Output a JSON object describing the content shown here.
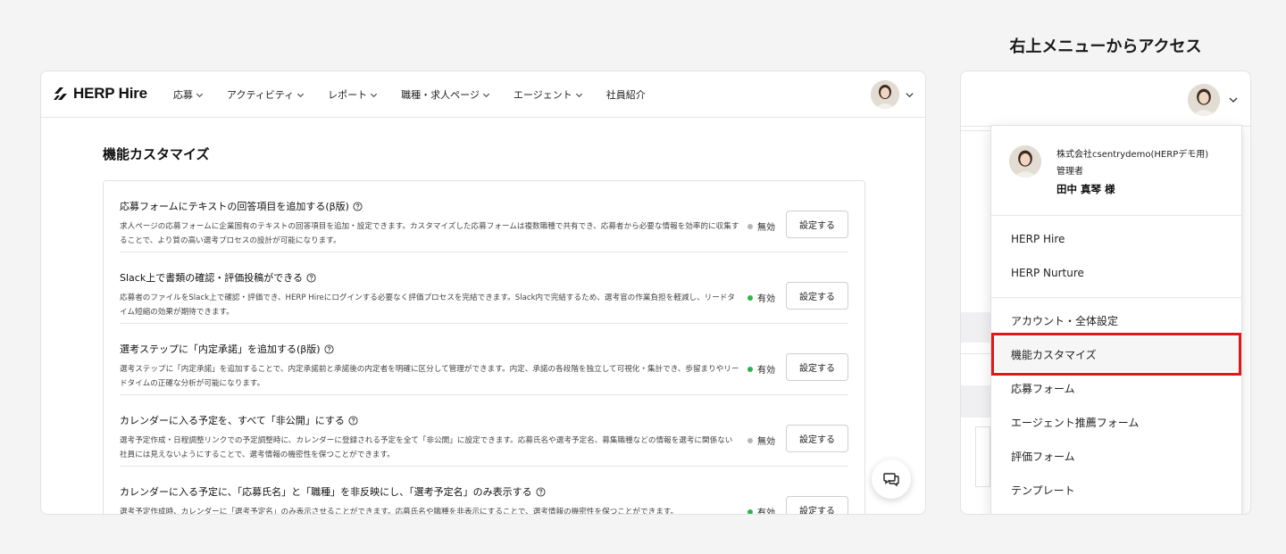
{
  "app": {
    "logo_text": "HERP Hire"
  },
  "nav": {
    "items": [
      {
        "label": "応募",
        "has_dropdown": true
      },
      {
        "label": "アクティビティ",
        "has_dropdown": true
      },
      {
        "label": "レポート",
        "has_dropdown": true
      },
      {
        "label": "職種・求人ページ",
        "has_dropdown": true
      },
      {
        "label": "エージェント",
        "has_dropdown": true
      },
      {
        "label": "社員紹介",
        "has_dropdown": false
      }
    ]
  },
  "page": {
    "title": "機能カスタマイズ"
  },
  "features": [
    {
      "title": "応募フォームにテキストの回答項目を追加する(β版)",
      "description": "求人ページの応募フォームに企業固有のテキストの回答項目を追加・設定できます。カスタマイズした応募フォームは複数職種で共有でき、応募者から必要な情報を効率的に収集することで、より質の高い選考プロセスの設計が可能になります。",
      "status": "無効",
      "enabled": false,
      "button": "設定する"
    },
    {
      "title": "Slack上で書類の確認・評価投稿ができる",
      "description": "応募者のファイルをSlack上で確認・評価でき、HERP Hireにログインする必要なく評価プロセスを完結できます。Slack内で完結するため、選考官の作業負担を軽減し、リードタイム短縮の効果が期待できます。",
      "status": "有効",
      "enabled": true,
      "button": "設定する"
    },
    {
      "title": "選考ステップに「内定承諾」を追加する(β版)",
      "description": "選考ステップに「内定承諾」を追加することで、内定承諾前と承諾後の内定者を明確に区分して管理ができます。内定、承諾の各段階を独立して可視化・集計でき、歩留まりやリードタイムの正確な分析が可能になります。",
      "status": "有効",
      "enabled": true,
      "button": "設定する"
    },
    {
      "title": "カレンダーに入る予定を、すべて「非公開」にする",
      "description": "選考予定作成・日程調整リンクでの予定調整時に、カレンダーに登録される予定を全て「非公開」に設定できます。応募氏名や選考予定名、募集職種などの情報を選考に関係ない社員には見えないようにすることで、選考情報の機密性を保つことができます。",
      "status": "無効",
      "enabled": false,
      "button": "設定する"
    },
    {
      "title": "カレンダーに入る予定に、「応募氏名」と「職種」を非反映にし、「選考予定名」のみ表示する",
      "description": "選考予定作成時、カレンダーに「選考予定名」のみ表示させることができます。応募氏名や職種を非表示にすることで、選考情報の機密性を保つことができます。",
      "status": "有効",
      "enabled": true,
      "button": "設定する"
    }
  ],
  "right_panel": {
    "caption": "右上メニューからアクセス",
    "user": {
      "company": "株式会社csentrydemo(HERPデモ用)",
      "role": "管理者",
      "name": "田中 真琴 様"
    },
    "menu": {
      "products": [
        "HERP Hire",
        "HERP Nurture"
      ],
      "settings": [
        "アカウント・全体設定",
        "機能カスタマイズ",
        "応募フォーム",
        "エージェント推薦フォーム",
        "評価フォーム",
        "テンプレート"
      ]
    }
  },
  "colors": {
    "enabled_dot": "#2eb34c",
    "disabled_dot": "#b5b5b8",
    "highlight": "#e01818"
  },
  "icons": {
    "chevron": "chevron-down-icon",
    "help": "question-circle-icon",
    "chat": "chat-bubble-icon"
  }
}
